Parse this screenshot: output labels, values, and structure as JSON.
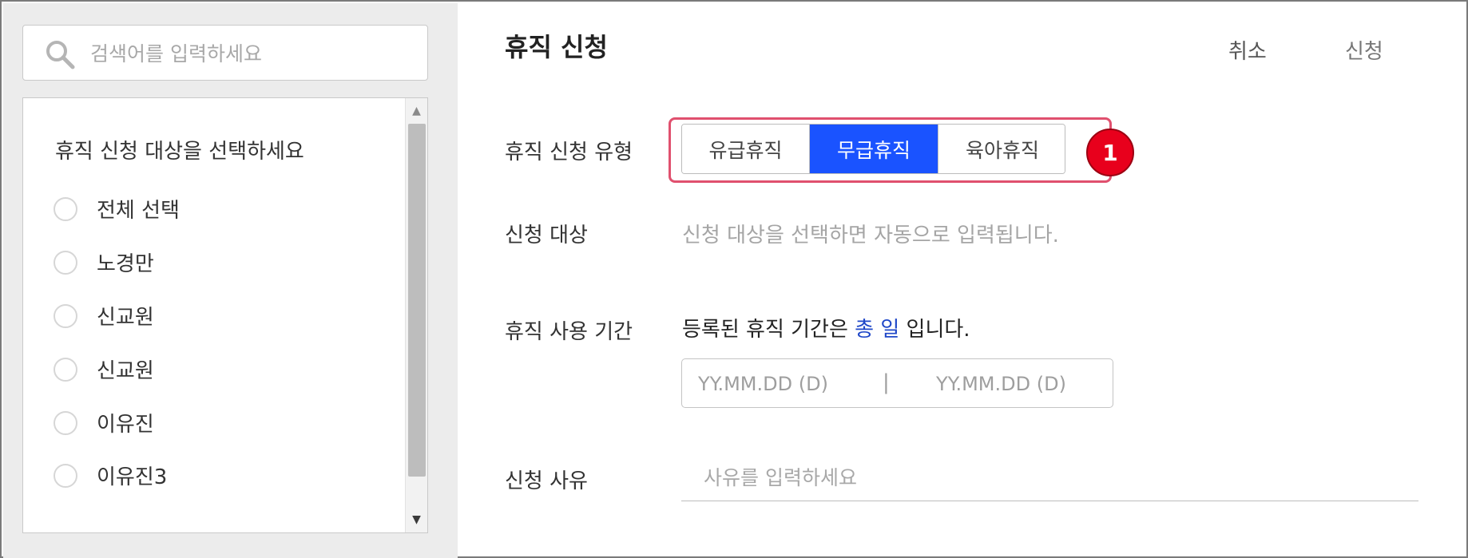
{
  "search": {
    "placeholder": "검색어를 입력하세요",
    "icon": "search-icon"
  },
  "target_list": {
    "heading": "휴직 신청 대상을 선택하세요",
    "items": [
      {
        "label": "전체 선택"
      },
      {
        "label": "노경만"
      },
      {
        "label": "신교원"
      },
      {
        "label": "신교원"
      },
      {
        "label": "이유진"
      },
      {
        "label": "이유진3"
      }
    ],
    "scroll_up_icon": "scroll-up-arrow-icon",
    "scroll_down_icon": "scroll-down-arrow-icon"
  },
  "header": {
    "title": "휴직 신청",
    "cancel_label": "취소",
    "apply_label": "신청"
  },
  "form": {
    "type_label": "휴직 신청 유형",
    "type_options": [
      "유급휴직",
      "무급휴직",
      "육아휴직"
    ],
    "type_selected": "무급휴직",
    "step_badge": "1",
    "target_label": "신청 대상",
    "target_hint": "신청 대상을 선택하면 자동으로 입력됩니다.",
    "period_label": "휴직 사용 기간",
    "period_prefix": "등록된 휴직 기간은",
    "period_total": "총",
    "period_days": "일",
    "period_suffix": "입니다.",
    "date_start_placeholder": "YY.MM.DD (D)",
    "date_separator": "|",
    "date_end_placeholder": "YY.MM.DD (D)",
    "reason_label": "신청 사유",
    "reason_placeholder": "사유를 입력하세요"
  },
  "colors": {
    "accent": "#1a53ff",
    "highlight": "#e0506e",
    "badge": "#e8001c",
    "link_text": "#1f47c8"
  }
}
